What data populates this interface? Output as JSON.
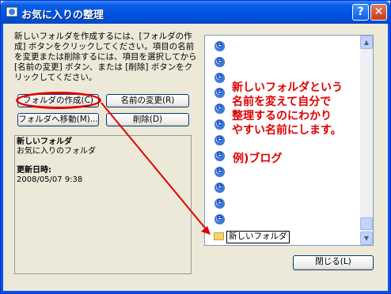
{
  "window": {
    "title": "お気に入りの整理",
    "help_label": "?",
    "close_label": "✕"
  },
  "instructions": "新しいフォルダを作成するには、[フォルダの作成] ボタンをクリックしてください。項目の名前を変更または削除するには、項目を選択してから [名前の変更] ボタン、または [削除] ボタンをクリックしてください。",
  "buttons": {
    "create_folder": "フォルダの作成(C)",
    "rename": "名前の変更(R)",
    "move_to_folder": "フォルダへ移動(M)...",
    "delete": "削除(D)",
    "close": "閉じる(L)"
  },
  "info": {
    "name": "新しいフォルダ",
    "type": "お気に入りのフォルダ",
    "modified_label": "更新日時:",
    "modified_value": "2008/05/07 9:38"
  },
  "list": {
    "new_folder_name": "新しいフォルダ"
  },
  "annotation": {
    "line1": "新しいフォルダという",
    "line2": "名前を変えて自分で",
    "line3": "整理するのにわかり",
    "line4": "やすい名前にします。",
    "example": "例)ブログ"
  },
  "colors": {
    "annotation": "#e00000",
    "titlebar": "#0054e3"
  }
}
